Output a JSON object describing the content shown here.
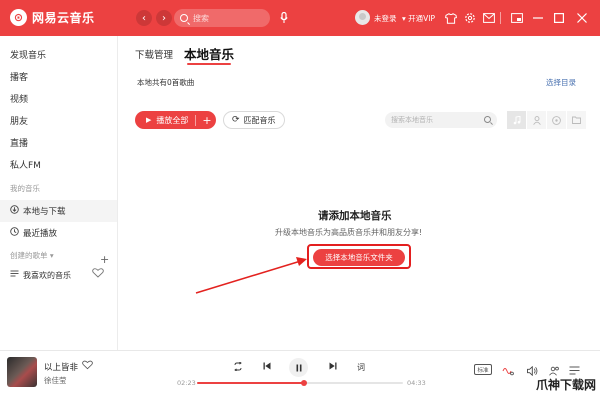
{
  "app": {
    "name": "网易云音乐",
    "logo_glyph": "⊙"
  },
  "titlebar": {
    "back_glyph": "‹",
    "forward_glyph": "›",
    "search_placeholder": "搜索",
    "mic_glyph": "🎙",
    "user_label": "未登录",
    "vip_label": "开通VIP",
    "accent_color": "#ec4141",
    "icons": [
      "tshirt-icon",
      "settings-icon",
      "mail-icon",
      "mini-mode-icon",
      "minimize-icon",
      "maximize-icon",
      "close-icon"
    ]
  },
  "sidebar": {
    "items": [
      {
        "label": "发现音乐"
      },
      {
        "label": "播客"
      },
      {
        "label": "视频"
      },
      {
        "label": "朋友"
      },
      {
        "label": "直播"
      },
      {
        "label": "私人FM"
      }
    ],
    "my_music_heading": "我的音乐",
    "my_music_items": [
      {
        "label": "本地与下载",
        "icon": "download-icon",
        "active": true
      },
      {
        "label": "最近播放",
        "icon": "clock-icon",
        "active": false
      }
    ],
    "created_heading": "创建的歌单",
    "created_heading_arrow": "▾",
    "favorites_label": "我喜欢的音乐"
  },
  "main": {
    "tab_download": "下载管理",
    "tab_local": "本地音乐",
    "count_text": "本地共有0首歌曲",
    "select_dir": "选择目录",
    "play_all_label": "播放全部",
    "match_label": "匹配音乐",
    "search_placeholder": "搜索本地音乐",
    "empty_title": "请添加本地音乐",
    "empty_subtitle": "升级本地音乐为高品质音乐并和朋友分享!",
    "choose_folder_label": "选择本地音乐文件夹"
  },
  "player": {
    "song_title": "以上皆非",
    "artist": "徐佳莹",
    "time_current": "02:23",
    "time_total": "04:33",
    "progress": 0.52,
    "quality_label": "标准",
    "lyrics_glyph": "词"
  },
  "watermark": "爪神下载网"
}
